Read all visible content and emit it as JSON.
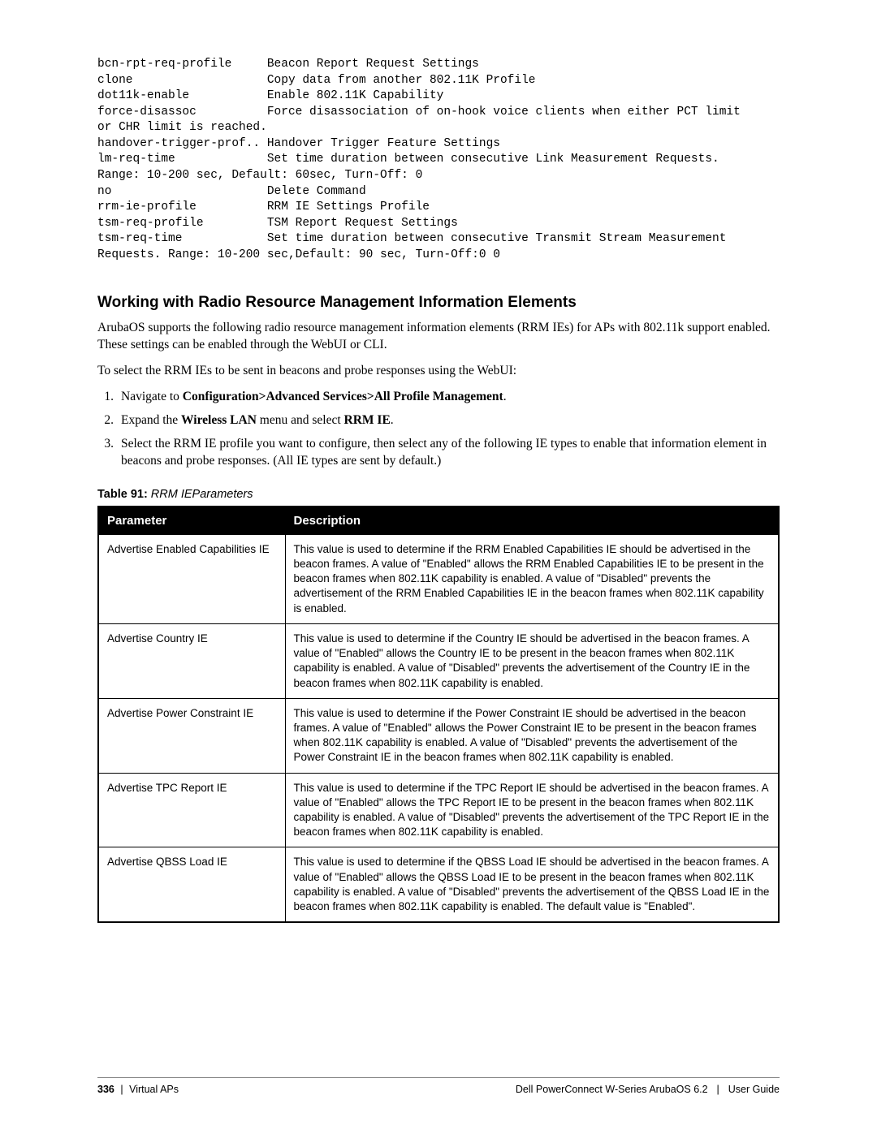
{
  "code_block": "bcn-rpt-req-profile     Beacon Report Request Settings\nclone                   Copy data from another 802.11K Profile\ndot11k-enable           Enable 802.11K Capability\nforce-disassoc          Force disassociation of on-hook voice clients when either PCT limit\nor CHR limit is reached.\nhandover-trigger-prof.. Handover Trigger Feature Settings\nlm-req-time             Set time duration between consecutive Link Measurement Requests.\nRange: 10-200 sec, Default: 60sec, Turn-Off: 0\nno                      Delete Command\nrrm-ie-profile          RRM IE Settings Profile\ntsm-req-profile         TSM Report Request Settings\ntsm-req-time            Set time duration between consecutive Transmit Stream Measurement\nRequests. Range: 10-200 sec,Default: 90 sec, Turn-Off:0 0",
  "section_heading": "Working with Radio Resource Management Information Elements",
  "para1": "ArubaOS supports the following radio resource management information elements (RRM IEs) for APs with 802.11k support enabled. These settings can be enabled through the WebUI or CLI.",
  "para2": "To select the RRM IEs to be sent in beacons and probe responses using the WebUI:",
  "steps": [
    {
      "prefix": "Navigate to ",
      "bold": "Configuration>Advanced Services>All Profile Management",
      "suffix": "."
    },
    {
      "prefix": "Expand the ",
      "bold": "Wireless LAN",
      "mid": " menu and select ",
      "bold2": "RRM IE",
      "suffix": "."
    },
    {
      "prefix": "Select the RRM IE profile you want to configure, then select any of the following IE types to enable that information element in beacons and probe responses. (All IE types are sent by default.)",
      "bold": "",
      "suffix": ""
    }
  ],
  "table_caption_bold": "Table 91:",
  "table_caption_italic": " RRM IEParameters",
  "table": {
    "headers": [
      "Parameter",
      "Description"
    ],
    "rows": [
      {
        "param": "Advertise Enabled Capabilities IE",
        "desc": "This value is used to determine if the RRM Enabled Capabilities IE should be advertised in the beacon frames. A value of \"Enabled\" allows the RRM Enabled Capabilities IE to be present in the beacon frames when 802.11K capability is enabled. A value of \"Disabled\" prevents the advertisement of the RRM Enabled Capabilities IE in the beacon frames when 802.11K capability is enabled."
      },
      {
        "param": "Advertise Country IE",
        "desc": "This value is used to determine if the Country IE should be advertised in the beacon frames. A value of \"Enabled\" allows the Country IE to be present in the beacon frames when 802.11K capability is enabled. A value of \"Disabled\" prevents the advertisement of the Country IE in the beacon frames when 802.11K capability is enabled."
      },
      {
        "param": "Advertise Power Constraint IE",
        "desc": "This value is used to determine if the Power Constraint IE should be advertised in the beacon frames. A value of \"Enabled\" allows the Power Constraint IE to be present in the beacon frames when 802.11K capability is enabled. A value of \"Disabled\" prevents the advertisement of the Power Constraint IE in the beacon frames when 802.11K capability is enabled."
      },
      {
        "param": "Advertise TPC Report IE",
        "desc": "This value is used to determine if the TPC Report IE should be advertised in the beacon frames. A value of \"Enabled\" allows the TPC Report IE to be present in the beacon frames when 802.11K capability is enabled. A value of \"Disabled\" prevents the advertisement of the TPC Report IE in the beacon frames when 802.11K capability is enabled."
      },
      {
        "param": "Advertise QBSS Load IE",
        "desc": "This value is used to determine if the QBSS Load IE should be advertised in the beacon frames. A value of \"Enabled\" allows the QBSS Load IE to be present in the beacon frames when 802.11K capability is enabled. A value of \"Disabled\" prevents the advertisement of the QBSS Load IE in the beacon frames when 802.11K capability is enabled. The default value is \"Enabled\"."
      }
    ]
  },
  "footer": {
    "page_number": "336",
    "left_text": "Virtual APs",
    "right_product": "Dell PowerConnect W-Series ArubaOS 6.2",
    "right_doc": "User Guide"
  }
}
